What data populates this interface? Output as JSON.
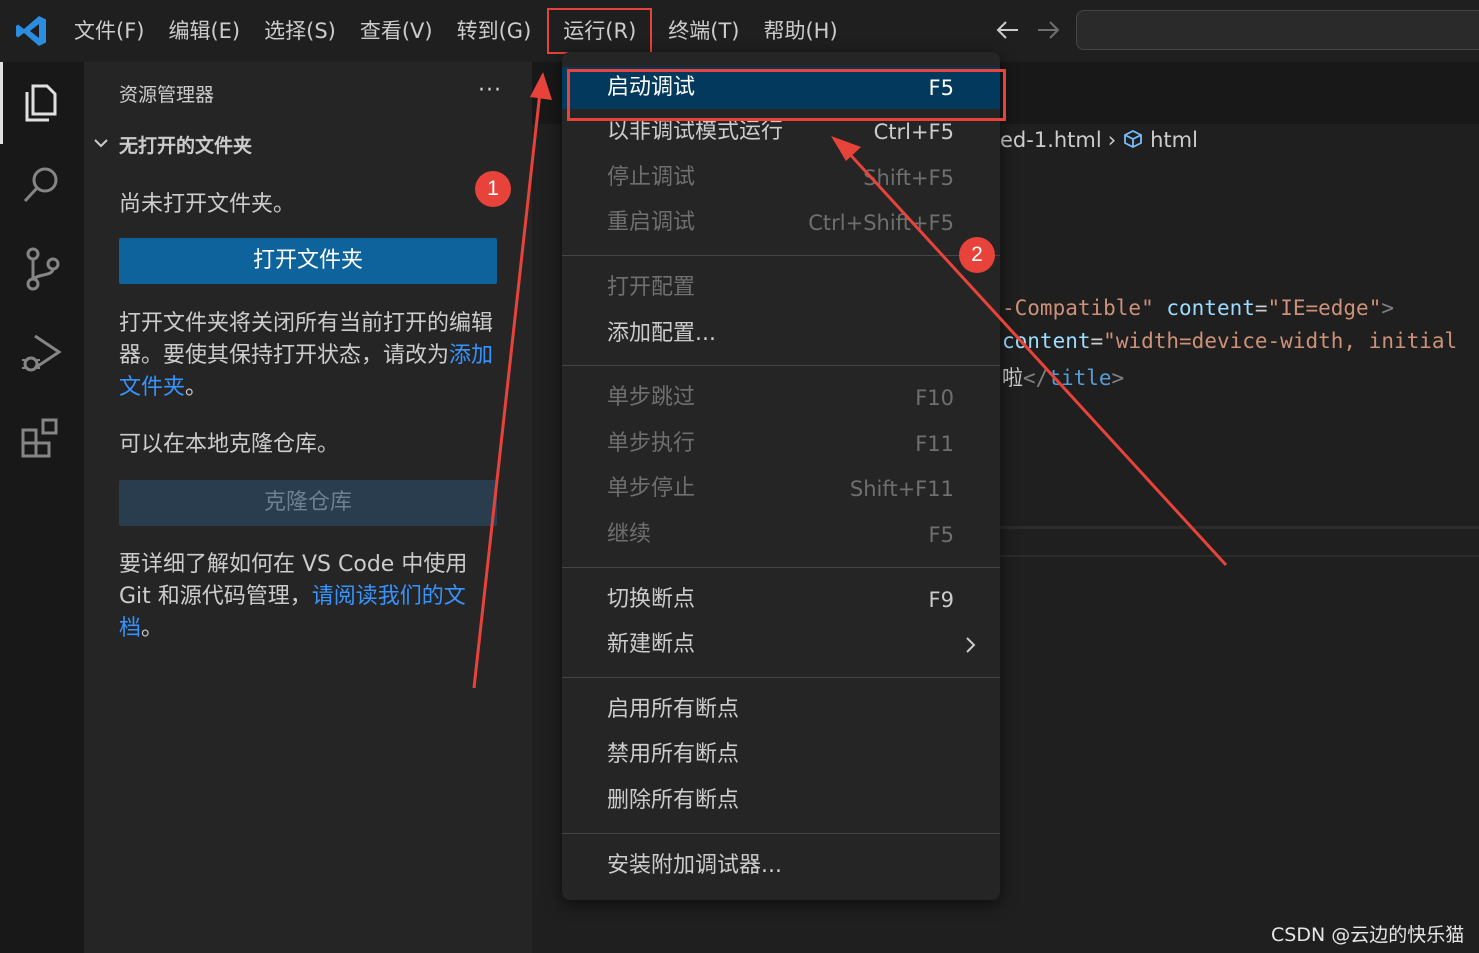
{
  "colors": {
    "accent": "#0e639c",
    "link": "#3794ff",
    "annotation": "#e8433a",
    "menu_selected": "#04395e",
    "string": "#ce9178",
    "attribute": "#9cdcfe",
    "tag": "#569cd6"
  },
  "menubar": {
    "items": [
      "文件(F)",
      "编辑(E)",
      "选择(S)",
      "查看(V)",
      "转到(G)",
      "运行(R)",
      "终端(T)",
      "帮助(H)"
    ],
    "active": "运行(R)"
  },
  "activity_bar": {
    "icons": [
      "explorer-icon",
      "search-icon",
      "source-control-icon",
      "run-debug-icon",
      "extensions-icon"
    ],
    "active": "explorer-icon"
  },
  "sidebar": {
    "title": "资源管理器",
    "more": "···",
    "section_title": "无打开的文件夹",
    "no_folder_text": "尚未打开文件夹。",
    "open_folder_button": "打开文件夹",
    "open_folder_desc_1": "打开文件夹将关闭所有当前打开的编辑器。要使其保持打开状态，请改为",
    "open_folder_desc_link": "添加文件夹",
    "open_folder_desc_2": "。",
    "clone_text": "可以在本地克隆仓库。",
    "clone_button": "克隆仓库",
    "learn_1": "要详细了解如何在 VS Code 中使用 Git 和源代码管理，",
    "learn_link": "请阅读我们的文档",
    "learn_2": "。"
  },
  "editor": {
    "breadcrumb_file": "ed-1.html",
    "breadcrumb_symbol": "html",
    "code": {
      "l1_a": "-Compatible\"",
      "l1_attr": "content",
      "l1_eq": "=",
      "l1_val": "\"IE=edge\"",
      "l1_end": ">",
      "l2_attr": "content",
      "l2_eq": "=",
      "l2_val": "\"width=device-width, initial",
      "l3_text": "啦",
      "l3_open": "</",
      "l3_tag": "title",
      "l3_close": ">"
    }
  },
  "run_menu": {
    "items": [
      {
        "label": "启动调试",
        "shortcut": "F5",
        "state": "selected"
      },
      {
        "label": "以非调试模式运行",
        "shortcut": "Ctrl+F5",
        "state": "enabled"
      },
      {
        "label": "停止调试",
        "shortcut": "Shift+F5",
        "state": "disabled"
      },
      {
        "label": "重启调试",
        "shortcut": "Ctrl+Shift+F5",
        "state": "disabled"
      },
      {
        "label": "打开配置",
        "shortcut": "",
        "state": "disabled"
      },
      {
        "label": "添加配置...",
        "shortcut": "",
        "state": "enabled"
      },
      {
        "label": "单步跳过",
        "shortcut": "F10",
        "state": "disabled"
      },
      {
        "label": "单步执行",
        "shortcut": "F11",
        "state": "disabled"
      },
      {
        "label": "单步停止",
        "shortcut": "Shift+F11",
        "state": "disabled"
      },
      {
        "label": "继续",
        "shortcut": "F5",
        "state": "disabled"
      },
      {
        "label": "切换断点",
        "shortcut": "F9",
        "state": "enabled"
      },
      {
        "label": "新建断点",
        "shortcut": "",
        "state": "submenu"
      },
      {
        "label": "启用所有断点",
        "shortcut": "",
        "state": "enabled"
      },
      {
        "label": "禁用所有断点",
        "shortcut": "",
        "state": "enabled"
      },
      {
        "label": "删除所有断点",
        "shortcut": "",
        "state": "enabled"
      },
      {
        "label": "安装附加调试器...",
        "shortcut": "",
        "state": "enabled"
      }
    ]
  },
  "annotations": {
    "badge_1": "1",
    "badge_2": "2"
  },
  "watermark": "CSDN @云边的快乐猫"
}
